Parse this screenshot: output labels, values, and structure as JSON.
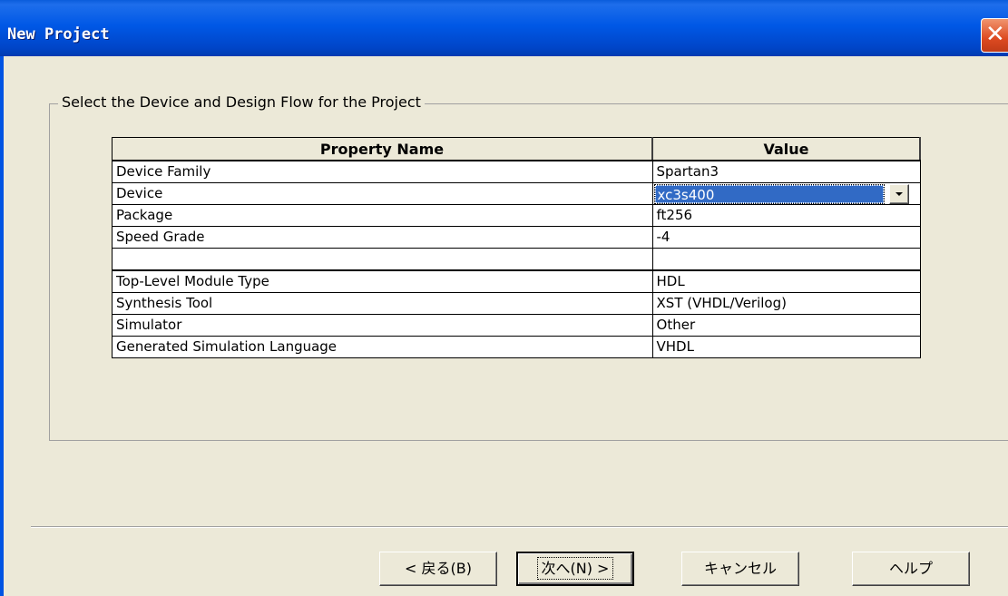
{
  "window": {
    "title": "New Project",
    "close_glyph": "✕"
  },
  "group": {
    "legend": "Select the Device and Design Flow for the Project"
  },
  "table": {
    "headers": {
      "name": "Property Name",
      "value": "Value"
    },
    "rows": [
      {
        "name": "Device Family",
        "value": "Spartan3"
      },
      {
        "name": "Device",
        "value": "xc3s400"
      },
      {
        "name": "Package",
        "value": "ft256"
      },
      {
        "name": "Speed Grade",
        "value": "-4"
      },
      {
        "name": "",
        "value": ""
      },
      {
        "name": "Top-Level Module Type",
        "value": "HDL"
      },
      {
        "name": "Synthesis Tool",
        "value": "XST (VHDL/Verilog)"
      },
      {
        "name": "Simulator",
        "value": "Other"
      },
      {
        "name": "Generated Simulation Language",
        "value": "VHDL"
      }
    ]
  },
  "buttons": {
    "back": "< 戻る(B)",
    "next": "次へ(N) >",
    "cancel": "キャンセル",
    "help": "ヘルプ"
  }
}
